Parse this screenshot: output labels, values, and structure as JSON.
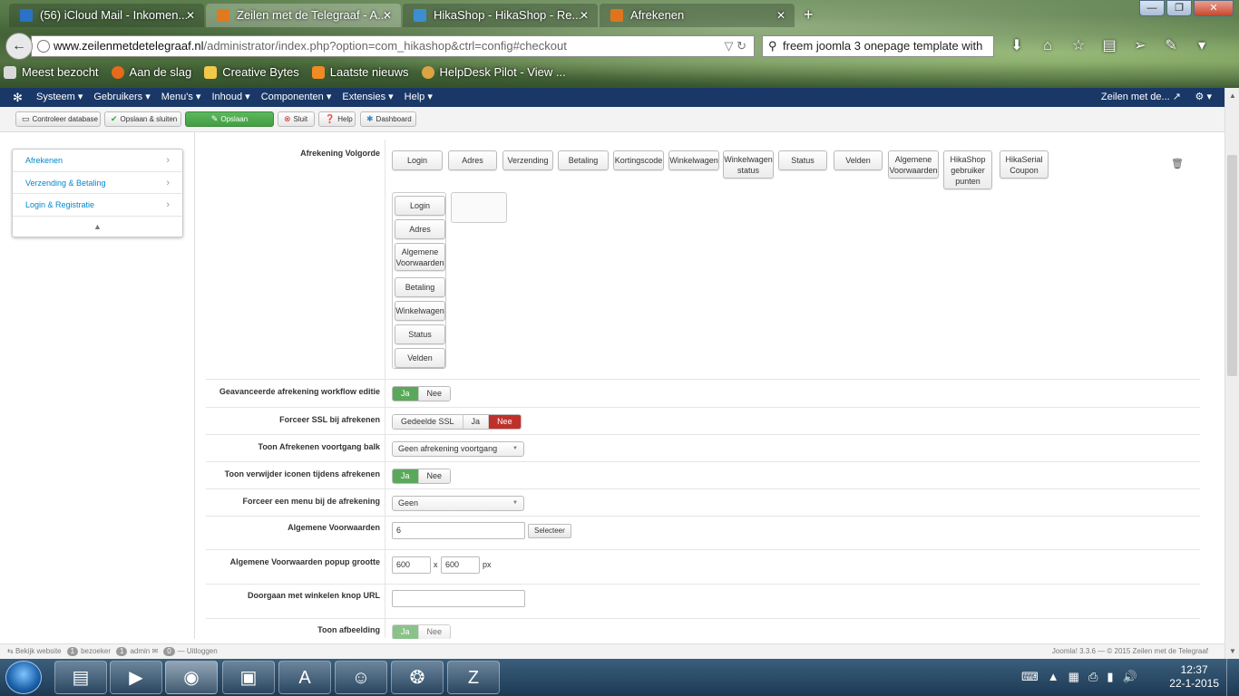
{
  "browser": {
    "tabs": [
      {
        "title": "(56) iCloud Mail - Inkomen...",
        "fav": "#2a72c8"
      },
      {
        "title": "Zeilen met de Telegraaf - A...",
        "fav": "#e07a1f"
      },
      {
        "title": "HikaShop - HikaShop - Re...",
        "fav": "#3b8fd0"
      },
      {
        "title": "Afrekenen",
        "fav": "#e0741c"
      }
    ],
    "new_tab": "+",
    "url_host": "www.zeilenmetdetelegraaf.nl",
    "url_path": "/administrator/index.php?option=com_hikashop&ctrl=config#checkout",
    "search_value": "freem joomla 3 onepage template with",
    "bookmarks": [
      {
        "label": "Meest bezocht",
        "color": "#d9d9d9"
      },
      {
        "label": "Aan de slag",
        "color": "#e66a1a"
      },
      {
        "label": "Creative Bytes",
        "color": "#f2c84b"
      },
      {
        "label": "Laatste nieuws",
        "color": "#f08a24"
      },
      {
        "label": "HelpDesk Pilot - View ...",
        "color": "#d9a441"
      }
    ]
  },
  "joomla": {
    "menu": [
      "Systeem ▾",
      "Gebruikers ▾",
      "Menu's ▾",
      "Inhoud ▾",
      "Componenten ▾",
      "Extensies ▾",
      "Help ▾"
    ],
    "site_name": "Zeilen met de...",
    "toolbar": {
      "check_db": "Controleer database",
      "save_close": "Opslaan & sluiten",
      "save": "Opslaan",
      "close": "Sluit",
      "help": "Help",
      "dashboard": "Dashboard"
    },
    "sidenav": [
      "Afrekenen",
      "Verzending & Betaling",
      "Login & Registratie"
    ],
    "footer": {
      "view_site": "Bekijk website",
      "visitors_count": "1",
      "visitors": "bezoeker",
      "admin_count": "1",
      "admin": "admin",
      "msg_count": "0",
      "logout": "Uitloggen",
      "version": "Joomla! 3.3.6 — © 2015 Zeilen met de Telegraaf"
    }
  },
  "config": {
    "order_label": "Afrekening Volgorde",
    "available": [
      "Login",
      "Adres",
      "Verzending",
      "Betaling",
      "Kortingscode",
      "Winkelwagen",
      "Winkelwagen status",
      "Status",
      "Velden",
      "Algemene Voorwaarden",
      "HikaShop gebruiker punten",
      "HikaSerial Coupon"
    ],
    "selected": [
      "Login",
      "Adres",
      "Algemene Voorwaarden",
      "Betaling",
      "Winkelwagen",
      "Status",
      "Velden"
    ],
    "rows": {
      "workflow": {
        "label": "Geavanceerde afrekening workflow editie",
        "yes": "Ja",
        "no": "Nee"
      },
      "ssl": {
        "label": "Forceer SSL bij afrekenen",
        "shared": "Gedeelde SSL",
        "yes": "Ja",
        "no": "Nee"
      },
      "progress": {
        "label": "Toon Afrekenen voortgang balk",
        "value": "Geen afrekening voortgang"
      },
      "delete_icons": {
        "label": "Toon verwijder iconen tijdens afrekenen",
        "yes": "Ja",
        "no": "Nee"
      },
      "force_menu": {
        "label": "Forceer een menu bij de afrekening",
        "value": "Geen"
      },
      "terms": {
        "label": "Algemene Voorwaarden",
        "value": "6",
        "button": "Selecteer"
      },
      "popup": {
        "label": "Algemene Voorwaarden popup grootte",
        "width": "600",
        "x": "x",
        "height": "600",
        "unit": "px"
      },
      "continue_url": {
        "label": "Doorgaan met winkelen knop URL",
        "value": ""
      },
      "show_image": {
        "label": "Toon afbeelding",
        "yes": "Ja",
        "no": "Nee"
      }
    }
  },
  "taskbar": {
    "time": "12:37",
    "date": "22-1-2015"
  }
}
